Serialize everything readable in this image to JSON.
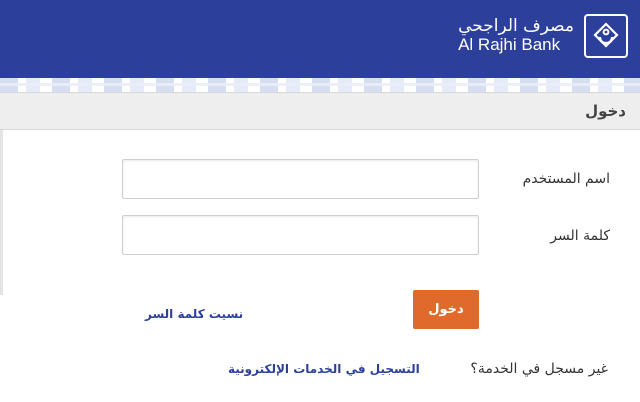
{
  "brand": {
    "name_ar": "مصرف الراجحي",
    "name_en": "Al Rajhi Bank",
    "header_color": "#2b3f9b",
    "accent_color": "#e06a2c"
  },
  "page": {
    "section_title": "دخول"
  },
  "form": {
    "username_label": "اسم المستخدم",
    "username_value": "",
    "password_label": "كلمة السر",
    "password_value": "",
    "login_button": "دخول",
    "forgot_password_link": "نسيت كلمة السر"
  },
  "footer": {
    "not_registered_question": "غير مسجل في الخدمة؟",
    "register_link": "التسجيل في الخدمات الإلكترونية"
  },
  "icons": {
    "logo": "al-rajhi-logo-icon"
  }
}
